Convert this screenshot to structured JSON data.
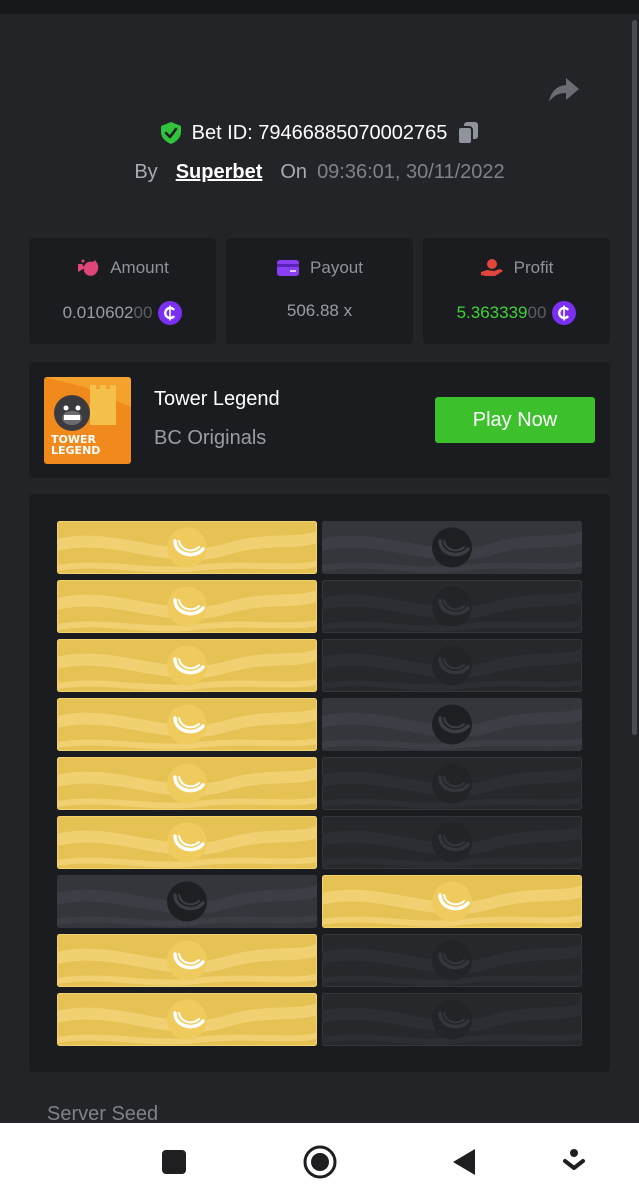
{
  "header": {
    "bet_id_label": "Bet ID: 79466885070002765",
    "by_label": "By",
    "provider": "Superbet",
    "on_label": "On",
    "timestamp": "09:36:01, 30/11/2022"
  },
  "stats": {
    "amount": {
      "label": "Amount",
      "value_main": "0.010602",
      "value_dim": "00",
      "icon": "money-bag-icon"
    },
    "payout": {
      "label": "Payout",
      "value": "506.88 x",
      "icon": "card-icon"
    },
    "profit": {
      "label": "Profit",
      "value_main": "5.363339",
      "value_dim": "00",
      "icon": "hand-coin-icon"
    }
  },
  "game": {
    "title": "Tower Legend",
    "subtitle": "BC Originals",
    "thumb_text_1": "TOWER",
    "thumb_text_2": "LEGEND",
    "play_label": "Play Now"
  },
  "board": {
    "rows": [
      [
        "gold",
        "dark-revealed"
      ],
      [
        "gold",
        "dark"
      ],
      [
        "gold",
        "dark"
      ],
      [
        "gold",
        "dark-revealed"
      ],
      [
        "gold",
        "dark"
      ],
      [
        "gold",
        "dark"
      ],
      [
        "dark-revealed",
        "gold"
      ],
      [
        "gold",
        "dark"
      ],
      [
        "gold",
        "dark"
      ]
    ]
  },
  "footer": {
    "server_seed_label": "Server Seed"
  },
  "colors": {
    "background": "#232428",
    "card": "#1b1c1f",
    "gold": "#e6c255",
    "play_button": "#3cc12d",
    "profit_green": "#3fd23a",
    "coin_purple": "#7b2ff2",
    "shield_green": "#2fc43a"
  }
}
